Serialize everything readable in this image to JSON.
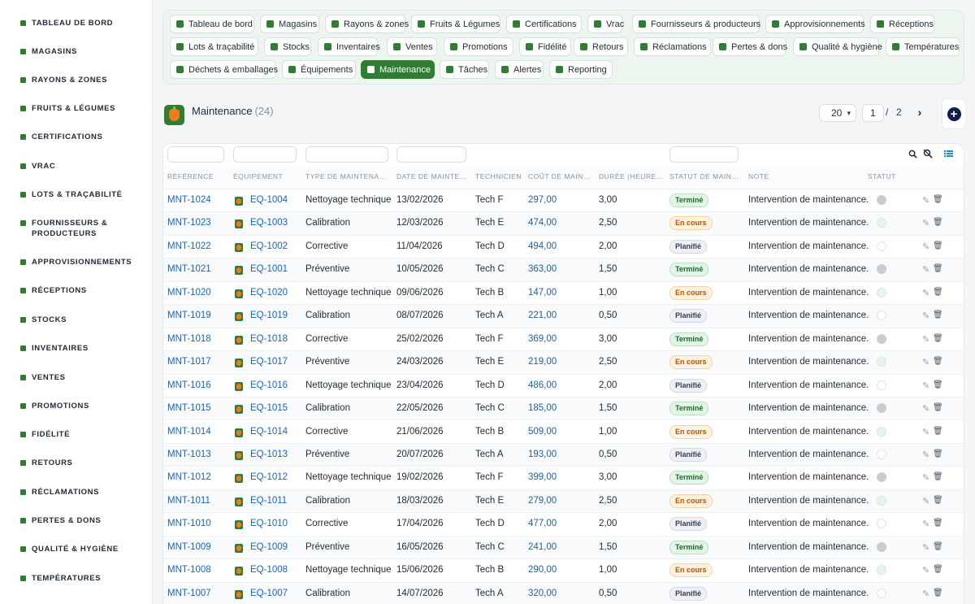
{
  "sidebar": {
    "items": [
      {
        "label": "TABLEAU DE BORD",
        "icon": "sprout-icon"
      },
      {
        "label": "MAGASINS",
        "icon": "store-icon"
      },
      {
        "label": "RAYONS & ZONES",
        "icon": "grid-icon"
      },
      {
        "label": "FRUITS & LÉGUMES",
        "icon": "leaf-icon"
      },
      {
        "label": "CERTIFICATIONS",
        "icon": "certificate-icon"
      },
      {
        "label": "VRAC",
        "icon": "bulk-icon"
      },
      {
        "label": "LOTS & TRAÇABILITÉ",
        "icon": "barcode-icon"
      },
      {
        "label": "FOURNISSEURS & PRODUCTEURS",
        "icon": "tractor-icon"
      },
      {
        "label": "APPROVISIONNEMENTS",
        "icon": "supply-icon"
      },
      {
        "label": "RÉCEPTIONS",
        "icon": "truck-icon"
      },
      {
        "label": "STOCKS",
        "icon": "box-icon"
      },
      {
        "label": "INVENTAIRES",
        "icon": "clipboard-icon"
      },
      {
        "label": "VENTES",
        "icon": "cart-icon"
      },
      {
        "label": "PROMOTIONS",
        "icon": "tag-icon"
      },
      {
        "label": "FIDÉLITÉ",
        "icon": "award-icon"
      },
      {
        "label": "RETOURS",
        "icon": "return-icon"
      },
      {
        "label": "RÉCLAMATIONS",
        "icon": "chat-icon"
      },
      {
        "label": "PERTES & DONS",
        "icon": "receipt-icon"
      },
      {
        "label": "QUALITÉ & HYGIÈNE",
        "icon": "checklist-icon"
      },
      {
        "label": "TEMPÉRATURES",
        "icon": "thermometer-icon"
      }
    ]
  },
  "nav": {
    "chips": [
      {
        "label": "Tableau de bord",
        "icon": "sprout-icon"
      },
      {
        "label": "Magasins",
        "icon": "store-icon"
      },
      {
        "label": "Rayons & zones",
        "icon": "grid-icon"
      },
      {
        "label": "Fruits & Légumes",
        "icon": "leaf-icon"
      },
      {
        "label": "Certifications",
        "icon": "certificate-icon"
      },
      {
        "label": "Vrac",
        "icon": "bulk-icon"
      },
      {
        "label": "Fournisseurs & producteurs",
        "icon": "tractor-icon"
      },
      {
        "label": "Approvisionnements",
        "icon": "supply-icon"
      },
      {
        "label": "Réceptions",
        "icon": "truck-icon"
      },
      {
        "label": "Lots & traçabilité",
        "icon": "barcode-icon"
      },
      {
        "label": "Stocks",
        "icon": "box-icon"
      },
      {
        "label": "Inventaires",
        "icon": "clipboard-icon"
      },
      {
        "label": "Ventes",
        "icon": "cart-icon"
      },
      {
        "label": "Promotions",
        "icon": "tag-icon"
      },
      {
        "label": "Fidélité",
        "icon": "award-icon"
      },
      {
        "label": "Retours",
        "icon": "return-icon"
      },
      {
        "label": "Réclamations",
        "icon": "chat-icon"
      },
      {
        "label": "Pertes & dons",
        "icon": "receipt-icon"
      },
      {
        "label": "Qualité & hygiène",
        "icon": "checklist-icon"
      },
      {
        "label": "Températures",
        "icon": "thermometer-icon"
      },
      {
        "label": "Déchets & emballages",
        "icon": "recycle-icon"
      },
      {
        "label": "Équipements",
        "icon": "equipment-icon"
      },
      {
        "label": "Maintenance",
        "icon": "tools-icon",
        "active": true
      },
      {
        "label": "Tâches",
        "icon": "list-icon"
      },
      {
        "label": "Alertes",
        "icon": "bell-icon"
      },
      {
        "label": "Reporting",
        "icon": "chart-icon"
      }
    ]
  },
  "page": {
    "title": "Maintenance",
    "count": "(24)"
  },
  "pager": {
    "page_size": "20",
    "current_page": "1",
    "separator": "/",
    "total_pages": "2",
    "next_glyph": "›",
    "add_glyph": "+"
  },
  "table": {
    "columns": [
      "RÉFÉRENCE",
      "ÉQUIPEMENT",
      "TYPE DE MAINTENANCE",
      "DATE DE MAINTENANCE",
      "TECHNICIEN",
      "COÛT DE MAINTENANCE",
      "DURÉE (HEURES)",
      "STATUT DE MAINTENANCE",
      "NOTE",
      "STATUT"
    ],
    "rows": [
      {
        "ref": "MNT-1024",
        "equip": "EQ-1004",
        "type": "Nettoyage technique",
        "date": "13/02/2026",
        "tech": "Tech F",
        "cost": "297,00",
        "duration": "3,00",
        "status": "Terminé",
        "note": "Intervention de maintenance."
      },
      {
        "ref": "MNT-1023",
        "equip": "EQ-1003",
        "type": "Calibration",
        "date": "12/03/2026",
        "tech": "Tech E",
        "cost": "474,00",
        "duration": "2,50",
        "status": "En cours",
        "note": "Intervention de maintenance."
      },
      {
        "ref": "MNT-1022",
        "equip": "EQ-1002",
        "type": "Corrective",
        "date": "11/04/2026",
        "tech": "Tech D",
        "cost": "494,00",
        "duration": "2,00",
        "status": "Planifié",
        "note": "Intervention de maintenance."
      },
      {
        "ref": "MNT-1021",
        "equip": "EQ-1001",
        "type": "Préventive",
        "date": "10/05/2026",
        "tech": "Tech C",
        "cost": "363,00",
        "duration": "1,50",
        "status": "Terminé",
        "note": "Intervention de maintenance."
      },
      {
        "ref": "MNT-1020",
        "equip": "EQ-1020",
        "type": "Nettoyage technique",
        "date": "09/06/2026",
        "tech": "Tech B",
        "cost": "147,00",
        "duration": "1,00",
        "status": "En cours",
        "note": "Intervention de maintenance."
      },
      {
        "ref": "MNT-1019",
        "equip": "EQ-1019",
        "type": "Calibration",
        "date": "08/07/2026",
        "tech": "Tech A",
        "cost": "221,00",
        "duration": "0,50",
        "status": "Planifié",
        "note": "Intervention de maintenance."
      },
      {
        "ref": "MNT-1018",
        "equip": "EQ-1018",
        "type": "Corrective",
        "date": "25/02/2026",
        "tech": "Tech F",
        "cost": "369,00",
        "duration": "3,00",
        "status": "Terminé",
        "note": "Intervention de maintenance."
      },
      {
        "ref": "MNT-1017",
        "equip": "EQ-1017",
        "type": "Préventive",
        "date": "24/03/2026",
        "tech": "Tech E",
        "cost": "219,00",
        "duration": "2,50",
        "status": "En cours",
        "note": "Intervention de maintenance."
      },
      {
        "ref": "MNT-1016",
        "equip": "EQ-1016",
        "type": "Nettoyage technique",
        "date": "23/04/2026",
        "tech": "Tech D",
        "cost": "486,00",
        "duration": "2,00",
        "status": "Planifié",
        "note": "Intervention de maintenance."
      },
      {
        "ref": "MNT-1015",
        "equip": "EQ-1015",
        "type": "Calibration",
        "date": "22/05/2026",
        "tech": "Tech C",
        "cost": "185,00",
        "duration": "1,50",
        "status": "Terminé",
        "note": "Intervention de maintenance."
      },
      {
        "ref": "MNT-1014",
        "equip": "EQ-1014",
        "type": "Corrective",
        "date": "21/06/2026",
        "tech": "Tech B",
        "cost": "509,00",
        "duration": "1,00",
        "status": "En cours",
        "note": "Intervention de maintenance."
      },
      {
        "ref": "MNT-1013",
        "equip": "EQ-1013",
        "type": "Préventive",
        "date": "20/07/2026",
        "tech": "Tech A",
        "cost": "193,00",
        "duration": "0,50",
        "status": "Planifié",
        "note": "Intervention de maintenance."
      },
      {
        "ref": "MNT-1012",
        "equip": "EQ-1012",
        "type": "Nettoyage technique",
        "date": "19/02/2026",
        "tech": "Tech F",
        "cost": "399,00",
        "duration": "3,00",
        "status": "Terminé",
        "note": "Intervention de maintenance."
      },
      {
        "ref": "MNT-1011",
        "equip": "EQ-1011",
        "type": "Calibration",
        "date": "18/03/2026",
        "tech": "Tech E",
        "cost": "279,00",
        "duration": "2,50",
        "status": "En cours",
        "note": "Intervention de maintenance."
      },
      {
        "ref": "MNT-1010",
        "equip": "EQ-1010",
        "type": "Corrective",
        "date": "17/04/2026",
        "tech": "Tech D",
        "cost": "477,00",
        "duration": "2,00",
        "status": "Planifié",
        "note": "Intervention de maintenance."
      },
      {
        "ref": "MNT-1009",
        "equip": "EQ-1009",
        "type": "Préventive",
        "date": "16/05/2026",
        "tech": "Tech C",
        "cost": "241,00",
        "duration": "1,50",
        "status": "Terminé",
        "note": "Intervention de maintenance."
      },
      {
        "ref": "MNT-1008",
        "equip": "EQ-1008",
        "type": "Nettoyage technique",
        "date": "15/06/2026",
        "tech": "Tech B",
        "cost": "290,00",
        "duration": "1,00",
        "status": "En cours",
        "note": "Intervention de maintenance."
      },
      {
        "ref": "MNT-1007",
        "equip": "EQ-1007",
        "type": "Calibration",
        "date": "14/07/2026",
        "tech": "Tech A",
        "cost": "320,00",
        "duration": "0,50",
        "status": "Planifié",
        "note": "Intervention de maintenance."
      }
    ]
  },
  "colors": {
    "accent": "#2e7d32",
    "link": "#1565c0",
    "status_active": "#c9cdd2",
    "status_inactive": "#e6f5ee"
  }
}
